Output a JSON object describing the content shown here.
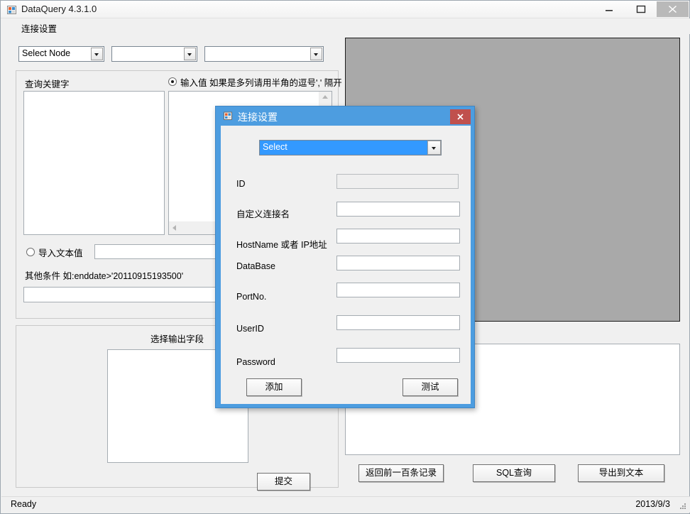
{
  "window": {
    "title": "DataQuery 4.3.1.0",
    "icon": "app-icon",
    "controls": {
      "minimize": "minimize-icon",
      "maximize": "maximize-icon",
      "close": "close-icon"
    }
  },
  "menu": {
    "items": [
      {
        "label": "连接设置"
      }
    ]
  },
  "left_panel": {
    "combos": [
      {
        "name": "select-node",
        "value": "Select Node"
      },
      {
        "name": "combo-two",
        "value": ""
      },
      {
        "name": "combo-three",
        "value": ""
      }
    ],
    "query_group": {
      "keyword_label": "查询关键字",
      "keyword_value": "",
      "radio_input": {
        "label": "输入值 如果是多列请用半角的逗号',' 隔开",
        "checked": true
      },
      "input_value": "",
      "radio_import": {
        "label": "导入文本值",
        "checked": false
      },
      "import_value": "",
      "other_cond_label": "其他条件 如:enddate>'20110915193500'",
      "other_cond_value": ""
    },
    "output_group": {
      "title": "选择输出字段",
      "list_value": "",
      "submit_label": "提交"
    }
  },
  "right_panel": {
    "grid_value": "",
    "result_value": "",
    "buttons": [
      {
        "name": "prev-100-records",
        "label": "返回前一百条记录"
      },
      {
        "name": "sql-query",
        "label": "SQL查询"
      },
      {
        "name": "export-to-text",
        "label": "导出到文本"
      }
    ]
  },
  "status_bar": {
    "status": "Ready",
    "date": "2013/9/3"
  },
  "modal": {
    "title": "连接设置",
    "icon": "app-icon",
    "close_label": "✕",
    "combo": {
      "value": "Select",
      "selected": true
    },
    "fields": [
      {
        "name": "id",
        "label": "ID",
        "value": "",
        "disabled": true
      },
      {
        "name": "custom-name",
        "label": "自定义连接名",
        "value": "",
        "disabled": false
      },
      {
        "name": "hostname",
        "label": "HostName 或者 IP地址",
        "value": "",
        "disabled": false
      },
      {
        "name": "database",
        "label": "DataBase",
        "value": "",
        "disabled": false
      },
      {
        "name": "portno",
        "label": "PortNo.",
        "value": "",
        "disabled": false
      },
      {
        "name": "userid",
        "label": "UserID",
        "value": "",
        "disabled": false
      },
      {
        "name": "password",
        "label": "Password",
        "value": "",
        "disabled": false
      }
    ],
    "buttons": {
      "add": "添加",
      "test": "测试"
    }
  },
  "colors": {
    "modal_titlebar": "#4d9de0",
    "modal_close": "#c0504d",
    "combo_selection": "#3399ff",
    "grid_background": "#a9a9a9",
    "window_background": "#f0f0f0"
  }
}
